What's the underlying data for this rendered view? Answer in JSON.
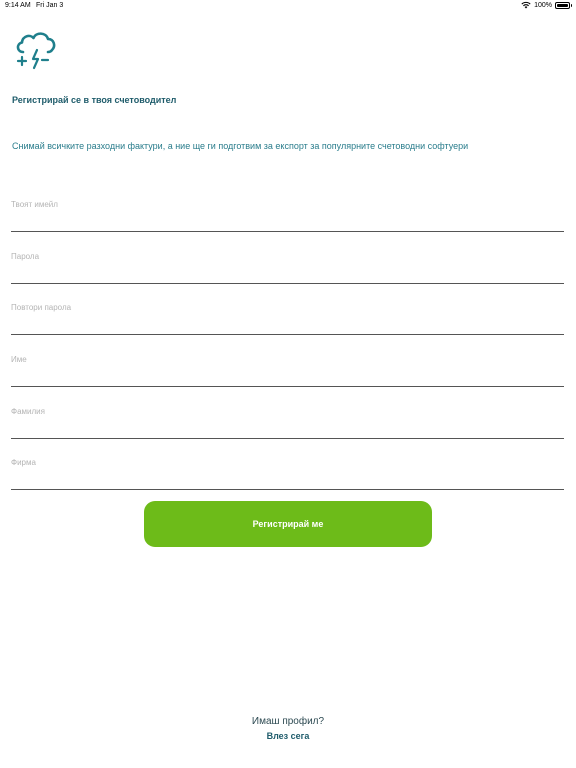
{
  "status_bar": {
    "time": "9:14 AM",
    "date": "Fri Jan 3",
    "battery": "100%"
  },
  "brand": {
    "logo_icon": "cloud-lightning-icon",
    "logo_color": "#1f7f8c"
  },
  "heading": "Регистрирай се в твоя счетоводител",
  "subtitle": "Снимай всичките разходни фактури, а ние ще ги подготвим за експорт за популярните счетоводни софтуери",
  "form": {
    "fields": [
      {
        "name": "username",
        "placeholder": "Твоят имейл",
        "value": ""
      },
      {
        "name": "password",
        "placeholder": "Парола",
        "value": ""
      },
      {
        "name": "repeat-password",
        "placeholder": "Повтори парола",
        "value": ""
      },
      {
        "name": "first-name",
        "placeholder": "Име",
        "value": ""
      },
      {
        "name": "last-name",
        "placeholder": "Фамилия",
        "value": ""
      },
      {
        "name": "company",
        "placeholder": "Фирма",
        "value": ""
      }
    ],
    "submit_label": "Регистрирай ме"
  },
  "footer": {
    "question": "Имаш профил?",
    "login_label": "Влез сега"
  },
  "colors": {
    "accent": "#6dbb19",
    "text_primary": "#1f5c6b",
    "text_secondary": "#2a7d8c"
  }
}
